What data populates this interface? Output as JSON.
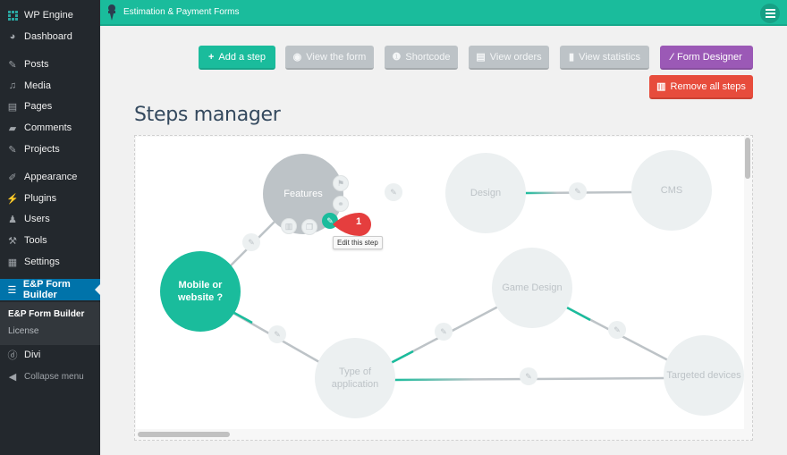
{
  "sidebar": {
    "items": [
      {
        "label": "WP Engine",
        "icon": "wp-engine-icon"
      },
      {
        "label": "Dashboard",
        "icon": "dashboard-icon"
      },
      {
        "label": "Posts",
        "icon": "pin-icon"
      },
      {
        "label": "Media",
        "icon": "media-icon"
      },
      {
        "label": "Pages",
        "icon": "pages-icon"
      },
      {
        "label": "Comments",
        "icon": "comment-icon"
      },
      {
        "label": "Projects",
        "icon": "pin-icon"
      },
      {
        "label": "Appearance",
        "icon": "brush-icon"
      },
      {
        "label": "Plugins",
        "icon": "plug-icon"
      },
      {
        "label": "Users",
        "icon": "user-icon"
      },
      {
        "label": "Tools",
        "icon": "wrench-icon"
      },
      {
        "label": "Settings",
        "icon": "settings-icon"
      },
      {
        "label": "E&P Form Builder",
        "icon": "form-icon",
        "active": true
      },
      {
        "label": "Divi",
        "icon": "divi-icon"
      },
      {
        "label": "Collapse menu",
        "icon": "collapse-icon"
      }
    ],
    "submenu": [
      {
        "label": "E&P Form Builder",
        "current": true
      },
      {
        "label": "License"
      }
    ]
  },
  "topbar": {
    "title": "Estimation & Payment Forms",
    "menu_icon": "list-icon"
  },
  "toolbar": {
    "add_step": "Add a step",
    "view_form": "View the form",
    "shortcode": "Shortcode",
    "view_orders": "View orders",
    "view_statistics": "View statistics",
    "form_designer": "Form Designer",
    "remove_all": "Remove all steps"
  },
  "colors": {
    "accent": "#1abc9c",
    "gray_button": "#bdc3c7",
    "purple": "#9b59b6",
    "red": "#e74c3c",
    "sidebar_bg": "#23282d",
    "sidebar_active": "#0073aa"
  },
  "main": {
    "title": "Steps manager"
  },
  "steps": [
    {
      "id": "start",
      "label": "Mobile or website ?",
      "type": "start"
    },
    {
      "id": "features",
      "label": "Features",
      "type": "selected"
    },
    {
      "id": "design",
      "label": "Design"
    },
    {
      "id": "cms",
      "label": "CMS"
    },
    {
      "id": "game",
      "label": "Game Design"
    },
    {
      "id": "type",
      "label": "Type of application"
    },
    {
      "id": "devices",
      "label": "Targeted devices"
    }
  ],
  "selected_actions": {
    "marker_number": "1",
    "tooltip": "Edit this step"
  }
}
